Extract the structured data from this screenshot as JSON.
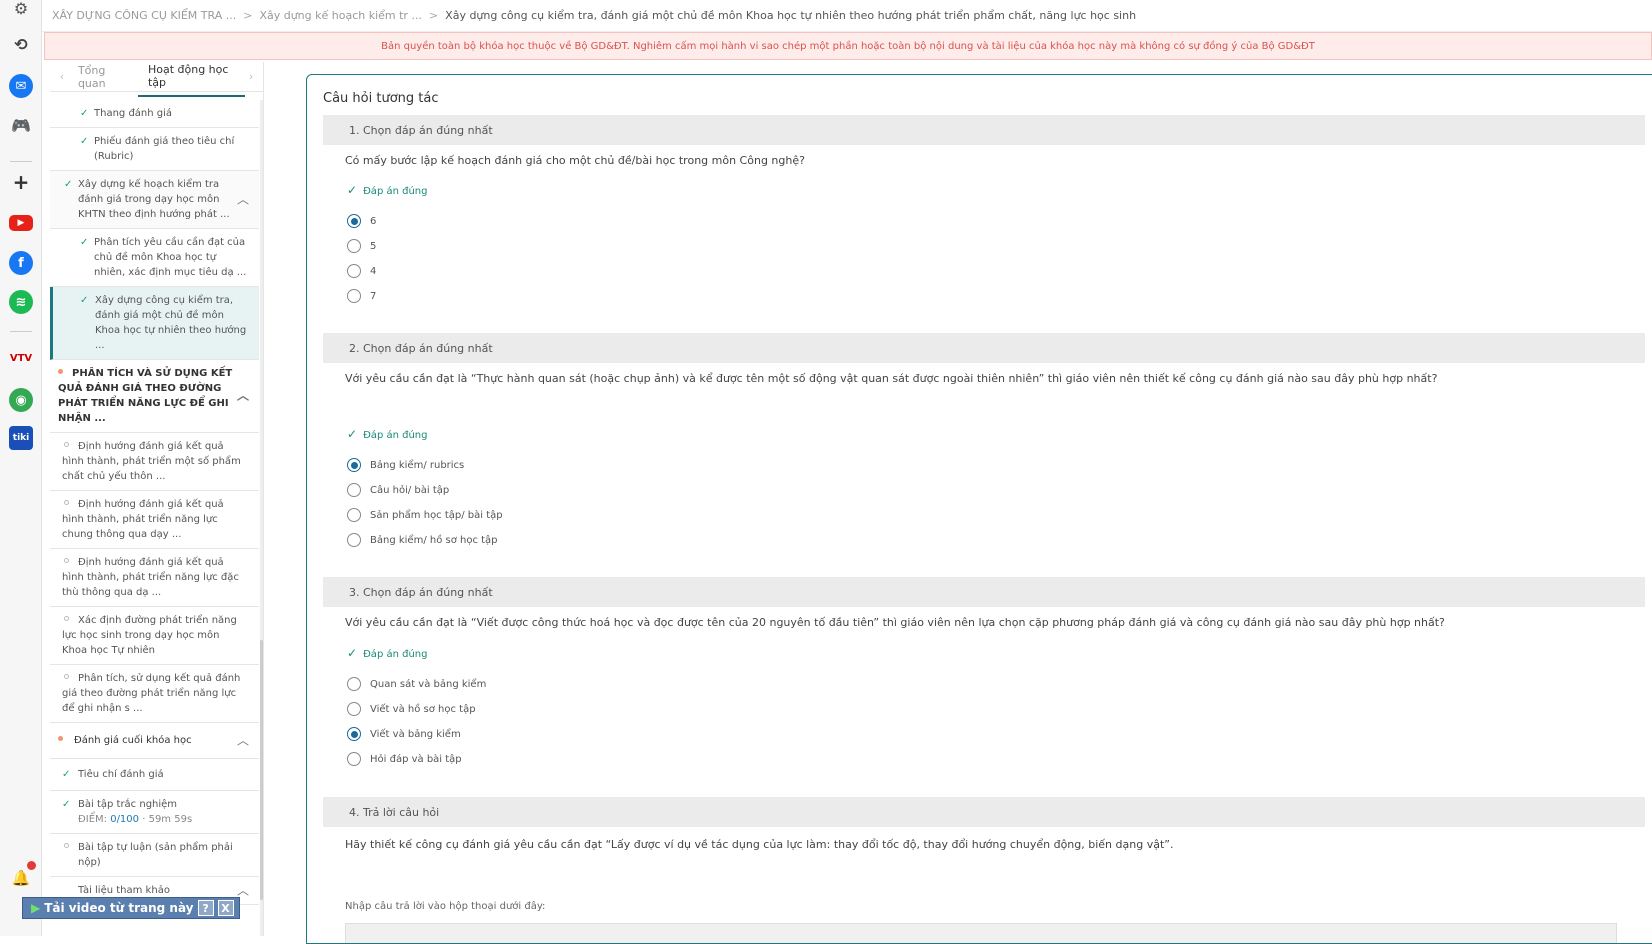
{
  "breadcrumb": {
    "items": [
      "XÂY DỰNG CÔNG CỤ KIỂM TRA ...",
      "Xây dựng kế hoạch kiểm tr ...",
      "Xây dựng công cụ kiểm tra, đánh giá một chủ đề môn Khoa học tự nhiên theo hướng phát triển phẩm chất, năng lực học sinh"
    ],
    "separator": ">"
  },
  "banner": {
    "text": "Bản quyền toàn bộ khóa học thuộc về Bộ GD&ĐT. Nghiêm cấm mọi hành vi sao chép một phần hoặc toàn bộ nội dung và tài liệu của khóa học này mà không có sự đồng ý của Bộ GD&ĐT"
  },
  "sidebar": {
    "tabs": [
      "Tổng quan",
      "Hoạt động học tập"
    ],
    "items": [
      {
        "text": "Thang đánh giá"
      },
      {
        "text": "Phiếu đánh giá theo tiêu chí (Rubric)"
      },
      {
        "text": "Xây dựng kế hoạch kiểm tra đánh giá trong dạy học môn KHTN theo định hướng phát ..."
      },
      {
        "text": "Phân tích yêu cầu cần đạt của chủ đề môn Khoa học tự nhiên, xác định mục tiêu dạ ..."
      },
      {
        "text": "Xây dựng công cụ kiểm tra, đánh giá một chủ đề môn Khoa học tự nhiên theo hướng ..."
      },
      {
        "text": "PHÂN TÍCH VÀ SỬ DỤNG KẾT QUẢ ĐÁNH GIÁ THEO ĐƯỜNG PHÁT TRIỂN NĂNG LỰC ĐỂ GHI NHẬN ..."
      },
      {
        "text": "Định hướng đánh giá kết quả hình thành, phát triển một số phẩm chất chủ yếu thôn ..."
      },
      {
        "text": "Định hướng đánh giá kết quả hình thành, phát triển năng lực chung thông qua dạy ..."
      },
      {
        "text": "Định hướng đánh giá kết quả hình thành, phát triển năng lực đặc thù thông qua dạ ..."
      },
      {
        "text": "Xác định đường phát triển năng lực học sinh trong dạy học môn Khoa học Tự nhiên"
      },
      {
        "text": "Phân tích, sử dụng kết quả đánh giá theo đường phát triển năng lực để ghi nhận s ..."
      },
      {
        "text": "Đánh giá cuối khóa học"
      },
      {
        "text": "Tiêu chí đánh giá"
      },
      {
        "text": "Bài tập trắc nghiệm",
        "score_label": "ĐIỂM:",
        "score": "0/100",
        "time": "· 59m 59s"
      },
      {
        "text": "Bài tập tự luận (sản phẩm phải nộp)"
      },
      {
        "text": "Tài liệu tham khảo"
      }
    ]
  },
  "content": {
    "section_title": "Câu hỏi tương tác",
    "correct_label": "Đáp án đúng",
    "questions": [
      {
        "heading": "1. Chọn đáp án đúng nhất",
        "text": "Có mấy bước lập kế hoạch đánh giá cho một chủ đề/bài học trong môn Công nghệ?",
        "options": [
          "6",
          "5",
          "4",
          "7"
        ],
        "selected": 0
      },
      {
        "heading": "2. Chọn đáp án đúng nhất",
        "text": "Với yêu cầu cần đạt là “Thực hành quan sát (hoặc chụp ảnh) và kể được tên một số động vật quan sát được ngoài thiên nhiên” thì giáo viên nên thiết kế công cụ đánh giá nào sau đây phù hợp nhất?",
        "options": [
          "Bảng kiểm/ rubrics",
          "Câu hỏi/ bài tập",
          "Sản phẩm học tập/ bài tập",
          "Bảng kiểm/ hồ sơ học tập"
        ],
        "selected": 0
      },
      {
        "heading": "3. Chọn đáp án đúng nhất",
        "text": "Với yêu cầu cần đạt là “Viết được công thức hoá học và đọc được tên của 20 nguyên tố đầu tiên” thì giáo viên nên lựa chọn cặp phương pháp đánh giá và công cụ đánh giá nào sau đây phù hợp nhất?",
        "options": [
          "Quan sát và bảng kiểm",
          "Viết và hồ sơ học tập",
          "Viết và bảng kiểm",
          "Hỏi đáp và bài tập"
        ],
        "selected": 2
      },
      {
        "heading": "4. Trả lời câu hỏi",
        "text": "Hãy thiết kế công cụ đánh giá yêu cầu cần đạt “Lấy được ví dụ về tác dụng của lực làm: thay đổi tốc độ, thay đổi hướng chuyển động, biến dạng vật”."
      }
    ],
    "answer_hint": "Nhập câu trả lời vào hộp thoại dưới đây:"
  },
  "download_bar": {
    "label": "Tải video từ trang này",
    "help": "?",
    "close": "X"
  },
  "rail_icons": [
    "gear-icon",
    "history-icon",
    "messenger-icon",
    "gamepad-icon",
    "plus-icon",
    "youtube-icon",
    "facebook-icon",
    "spotify-icon",
    "vtv-go-icon",
    "map-app-icon",
    "tiki-icon",
    "bell-icon"
  ]
}
